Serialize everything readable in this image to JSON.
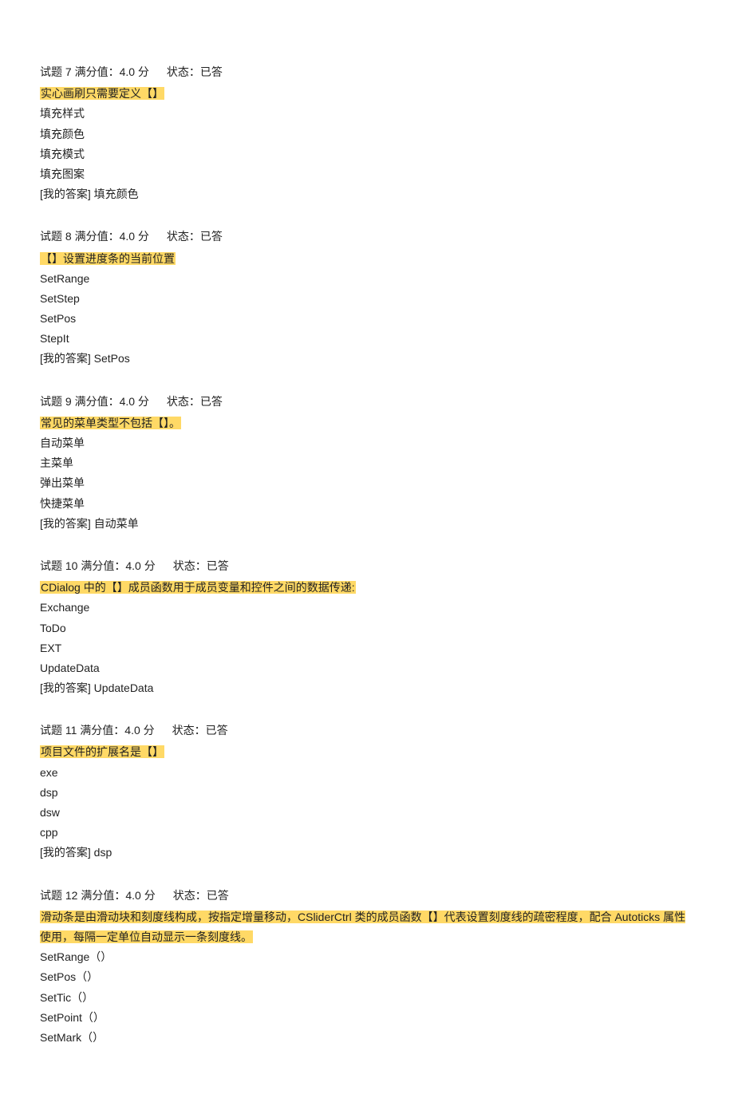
{
  "questions": [
    {
      "header": "试题 7  满分值：4.0 分",
      "status": "状态：已答",
      "stem": " 实心画刷只需要定义【】 ",
      "options": [
        "填充样式",
        "填充颜色",
        "填充模式",
        "填充图案"
      ],
      "answer": "[我的答案]  填充颜色"
    },
    {
      "header": "试题 8  满分值：4.0 分",
      "status": "状态：已答",
      "stem": " 【】设置进度条的当前位置 ",
      "options": [
        "SetRange",
        "SetStep",
        "SetPos",
        "StepIt"
      ],
      "answer": "[我的答案] SetPos"
    },
    {
      "header": "试题 9  满分值：4.0 分",
      "status": "状态：已答",
      "stem": " 常见的菜单类型不包括【】。 ",
      "options": [
        "自动菜单",
        "主菜单",
        "弹出菜单",
        "快捷菜单"
      ],
      "answer": "[我的答案]  自动菜单"
    },
    {
      "header": "试题 10  满分值：4.0 分",
      "status": "状态：已答",
      "stem": "CDialog 中的【】成员函数用于成员变量和控件之间的数据传递: ",
      "options": [
        "Exchange",
        "ToDo",
        "EXT",
        "UpdateData"
      ],
      "answer": "[我的答案] UpdateData"
    },
    {
      "header": "试题 11  满分值：4.0 分",
      "status": "状态：已答",
      "stem": "项目文件的扩展名是【】 ",
      "options": [
        "exe",
        "dsp",
        "dsw",
        "cpp"
      ],
      "answer": "[我的答案] dsp"
    },
    {
      "header": "试题 12  满分值：4.0 分",
      "status": "状态：已答",
      "stem": "滑动条是由滑动块和刻度线构成，按指定增量移动，CSliderCtrl 类的成员函数【】代表设置刻度线的疏密程度，配合 Autoticks 属性使用，每隔一定单位自动显示一条刻度线。",
      "options": [
        "SetRange（）",
        "SetPos（）",
        "SetTic（）",
        "SetPoint（）",
        "SetMark（）"
      ],
      "answer": ""
    }
  ]
}
